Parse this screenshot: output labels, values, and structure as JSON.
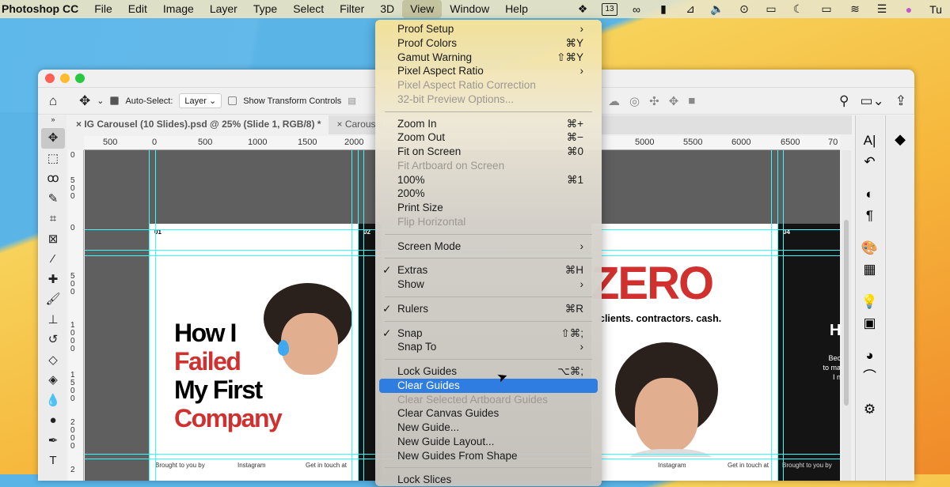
{
  "menubar": {
    "app": "Photoshop CC",
    "items": [
      "File",
      "Edit",
      "Image",
      "Layer",
      "Type",
      "Select",
      "Filter",
      "3D",
      "View",
      "Window",
      "Help"
    ],
    "active": "View",
    "status_icons": [
      "dropbox-icon",
      "calendar-icon",
      "creative-cloud-icon",
      "bookmark-icon",
      "vpn-icon",
      "volume-icon",
      "play-icon",
      "display-icon",
      "moon-icon",
      "battery-icon",
      "wifi-icon",
      "control-center-icon",
      "siri-icon"
    ],
    "calendar_day": "13",
    "clock_partial": "Tu"
  },
  "options": {
    "auto_select_label": "Auto-Select:",
    "auto_select_checked": true,
    "layer_select": "Layer",
    "show_transform_label": "Show Transform Controls",
    "show_transform_checked": false
  },
  "tabs": [
    {
      "label": "IG Carousel (10 Slides).psd @ 25% (Slide 1, RGB/8) *",
      "active": true
    },
    {
      "label": "Carousel",
      "active": false
    }
  ],
  "ruler": {
    "h": [
      "500",
      "0",
      "500",
      "1000",
      "1500",
      "2000",
      "5000",
      "5500",
      "6000",
      "6500",
      "70"
    ],
    "v": [
      "0",
      "500",
      "0",
      "500",
      "1000",
      "1500",
      "2000",
      "2"
    ]
  },
  "canvas": {
    "slide1": {
      "num": "01",
      "line1": "How I",
      "line2": "Failed",
      "line3": "My First",
      "line4": "Company",
      "foot": [
        "Brought to you by",
        "Instagram",
        "Get in touch at"
      ]
    },
    "slide2": {
      "num": "02"
    },
    "slide3": {
      "title": "ZERO",
      "subtitle": "clients. contractors. cash.",
      "foot": [
        "Instagram",
        "Get in touch at"
      ]
    },
    "slide4": {
      "num": "04",
      "title": "H",
      "body": [
        "Bec",
        "to ma",
        "I n"
      ],
      "foot": "Brought to you by"
    },
    "accent": "#d0302e"
  },
  "view_menu": [
    {
      "label": "Proof Setup",
      "submenu": true
    },
    {
      "label": "Proof Colors",
      "shortcut": "⌘Y"
    },
    {
      "label": "Gamut Warning",
      "shortcut": "⇧⌘Y"
    },
    {
      "label": "Pixel Aspect Ratio",
      "submenu": true
    },
    {
      "label": "Pixel Aspect Ratio Correction",
      "disabled": true
    },
    {
      "label": "32-bit Preview Options...",
      "disabled": true
    },
    {
      "sep": true
    },
    {
      "label": "Zoom In",
      "shortcut": "⌘+"
    },
    {
      "label": "Zoom Out",
      "shortcut": "⌘−"
    },
    {
      "label": "Fit on Screen",
      "shortcut": "⌘0"
    },
    {
      "label": "Fit Artboard on Screen",
      "disabled": true
    },
    {
      "label": "100%",
      "shortcut": "⌘1"
    },
    {
      "label": "200%"
    },
    {
      "label": "Print Size"
    },
    {
      "label": "Flip Horizontal",
      "disabled": true
    },
    {
      "sep": true
    },
    {
      "label": "Screen Mode",
      "submenu": true
    },
    {
      "sep": true
    },
    {
      "label": "Extras",
      "shortcut": "⌘H",
      "checked": true
    },
    {
      "label": "Show",
      "submenu": true
    },
    {
      "sep": true
    },
    {
      "label": "Rulers",
      "shortcut": "⌘R",
      "checked": true
    },
    {
      "sep": true
    },
    {
      "label": "Snap",
      "shortcut": "⇧⌘;",
      "checked": true
    },
    {
      "label": "Snap To",
      "submenu": true
    },
    {
      "sep": true
    },
    {
      "label": "Lock Guides",
      "shortcut": "⌥⌘;"
    },
    {
      "label": "Clear Guides",
      "highlighted": true
    },
    {
      "label": "Clear Selected Artboard Guides",
      "disabled": true
    },
    {
      "label": "Clear Canvas Guides"
    },
    {
      "label": "New Guide..."
    },
    {
      "label": "New Guide Layout..."
    },
    {
      "label": "New Guides From Shape"
    },
    {
      "sep": true
    },
    {
      "label": "Lock Slices"
    }
  ]
}
